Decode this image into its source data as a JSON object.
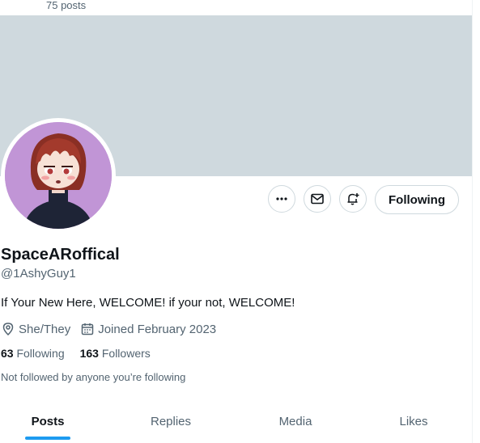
{
  "header": {
    "posts_count": "75 posts"
  },
  "actions": {
    "more_icon": "ellipsis-icon",
    "message_icon": "envelope-icon",
    "notify_icon": "bell-plus-icon",
    "following_label": "Following"
  },
  "profile": {
    "display_name": "SpaceARoffical",
    "handle": "@1AshyGuy1",
    "bio": "If Your New Here, WELCOME! if your not, WELCOME!",
    "pronouns": "She/They",
    "joined": "Joined February 2023",
    "following_count": "63",
    "following_label": "Following",
    "followers_count": "163",
    "followers_label": "Followers",
    "followed_note": "Not followed by anyone you’re following"
  },
  "tabs": [
    {
      "label": "Posts",
      "active": true
    },
    {
      "label": "Replies",
      "active": false
    },
    {
      "label": "Media",
      "active": false
    },
    {
      "label": "Likes",
      "active": false
    }
  ],
  "colors": {
    "banner": "#cfd9de",
    "accent": "#1d9bf0",
    "secondary_text": "#536471",
    "avatar_background": "#c195d6"
  }
}
